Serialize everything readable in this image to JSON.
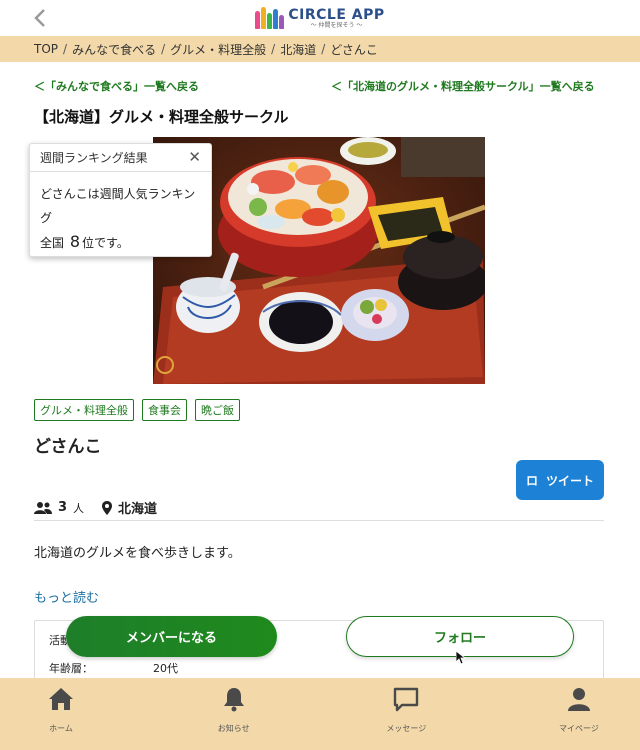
{
  "header": {
    "logo_title": "CIRCLE APP",
    "logo_tagline": "〜 仲間を探そう 〜"
  },
  "breadcrumb": [
    "TOP",
    "みんなで食べる",
    "グルメ・料理全般",
    "北海道",
    "どさんこ"
  ],
  "links": {
    "back_category": "＜「みんなで食べる」一覧へ戻る",
    "back_region": "＜「北海道のグルメ・料理全般サークル」一覧へ戻る"
  },
  "page_title": "【北海道】グルメ・料理全般サークル",
  "ranking_popup": {
    "title": "週間ランキング結果",
    "line1": "どさんこは週間人気ランキング",
    "prefix": "全国",
    "rank": "8",
    "suffix": "位です。"
  },
  "tags": [
    "グルメ・料理全般",
    "食事会",
    "晩ご飯"
  ],
  "circle": {
    "name": "どさんこ",
    "member_count": "3",
    "member_unit": "人",
    "location": "北海道",
    "description": "北海道のグルメを食べ歩きします。",
    "read_more": "もっと読む"
  },
  "tweet_button": {
    "icon": "ロ",
    "label": "ツイート"
  },
  "info": [
    {
      "key": "活動",
      "value": ""
    },
    {
      "key": "年齢層：",
      "value": "20代"
    }
  ],
  "actions": {
    "join": "メンバーになる",
    "follow": "フォロー"
  },
  "tabbar": [
    {
      "icon": "home-icon",
      "label": "ホーム"
    },
    {
      "icon": "bell-icon",
      "label": "お知らせ"
    },
    {
      "icon": "message-icon",
      "label": "メッセージ"
    },
    {
      "icon": "user-icon",
      "label": "マイページ"
    }
  ],
  "colors": {
    "accent_green": "#1f7a1f",
    "tab_bg": "#f3d9a9",
    "tweet_blue": "#1d82d6",
    "link_blue": "#1d6fa3"
  }
}
